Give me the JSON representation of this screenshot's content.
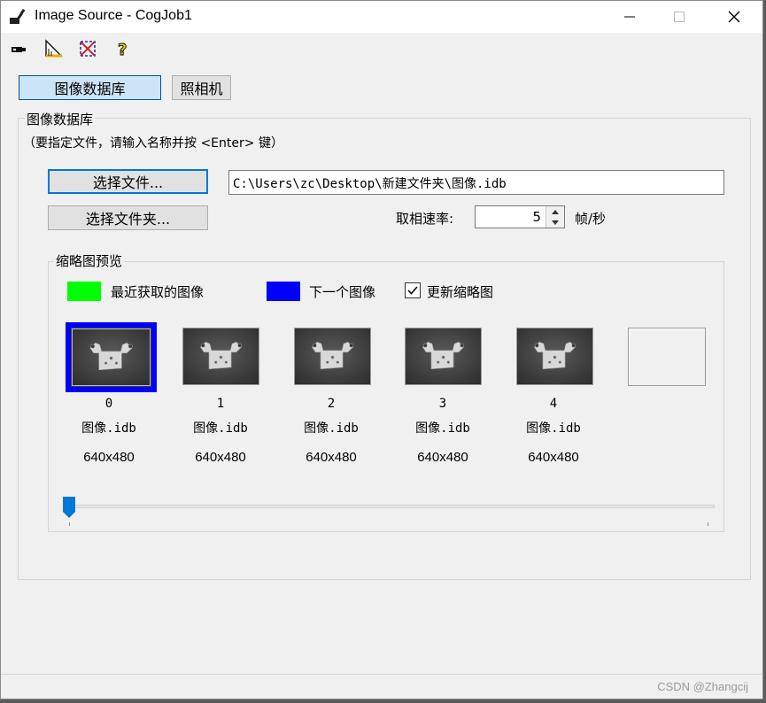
{
  "window": {
    "title": "Image Source - CogJob1",
    "app_icon": "cognex-app-icon",
    "controls": {
      "minimize_icon": "minimize-icon",
      "maximize_icon": "maximize-icon",
      "close_icon": "close-icon"
    }
  },
  "toolbar": {
    "items": [
      {
        "icon": "camera-icon"
      },
      {
        "icon": "ruler-triangle-icon"
      },
      {
        "icon": "crop-region-icon"
      },
      {
        "icon": "help-icon"
      }
    ]
  },
  "tabs": [
    {
      "label": "图像数据库",
      "active": true
    },
    {
      "label": "照相机",
      "active": false
    }
  ],
  "database": {
    "group_label": "图像数据库",
    "hint": "（要指定文件，请输入名称并按 <Enter> 键）",
    "select_file_label": "选择文件...",
    "select_folder_label": "选择文件夹...",
    "file_path": "C:\\Users\\zc\\Desktop\\新建文件夹\\图像.idb",
    "rate_label": "取相速率:",
    "rate_value": "5",
    "rate_unit": "帧/秒"
  },
  "preview": {
    "group_label": "缩略图预览",
    "legend_recent_label": "最近获取的图像",
    "legend_recent_color": "#00ff00",
    "legend_next_label": "下一个图像",
    "legend_next_color": "#0000ff",
    "update_checkbox_label": "更新缩略图",
    "update_checked": true,
    "thumbnails": [
      {
        "index": "0",
        "file": "图像.idb",
        "size": "640x480",
        "selected": true
      },
      {
        "index": "1",
        "file": "图像.idb",
        "size": "640x480",
        "selected": false
      },
      {
        "index": "2",
        "file": "图像.idb",
        "size": "640x480",
        "selected": false
      },
      {
        "index": "3",
        "file": "图像.idb",
        "size": "640x480",
        "selected": false
      },
      {
        "index": "4",
        "file": "图像.idb",
        "size": "640x480",
        "selected": false
      }
    ],
    "slider_value": 0
  },
  "watermark": "CSDN @Zhangcij"
}
